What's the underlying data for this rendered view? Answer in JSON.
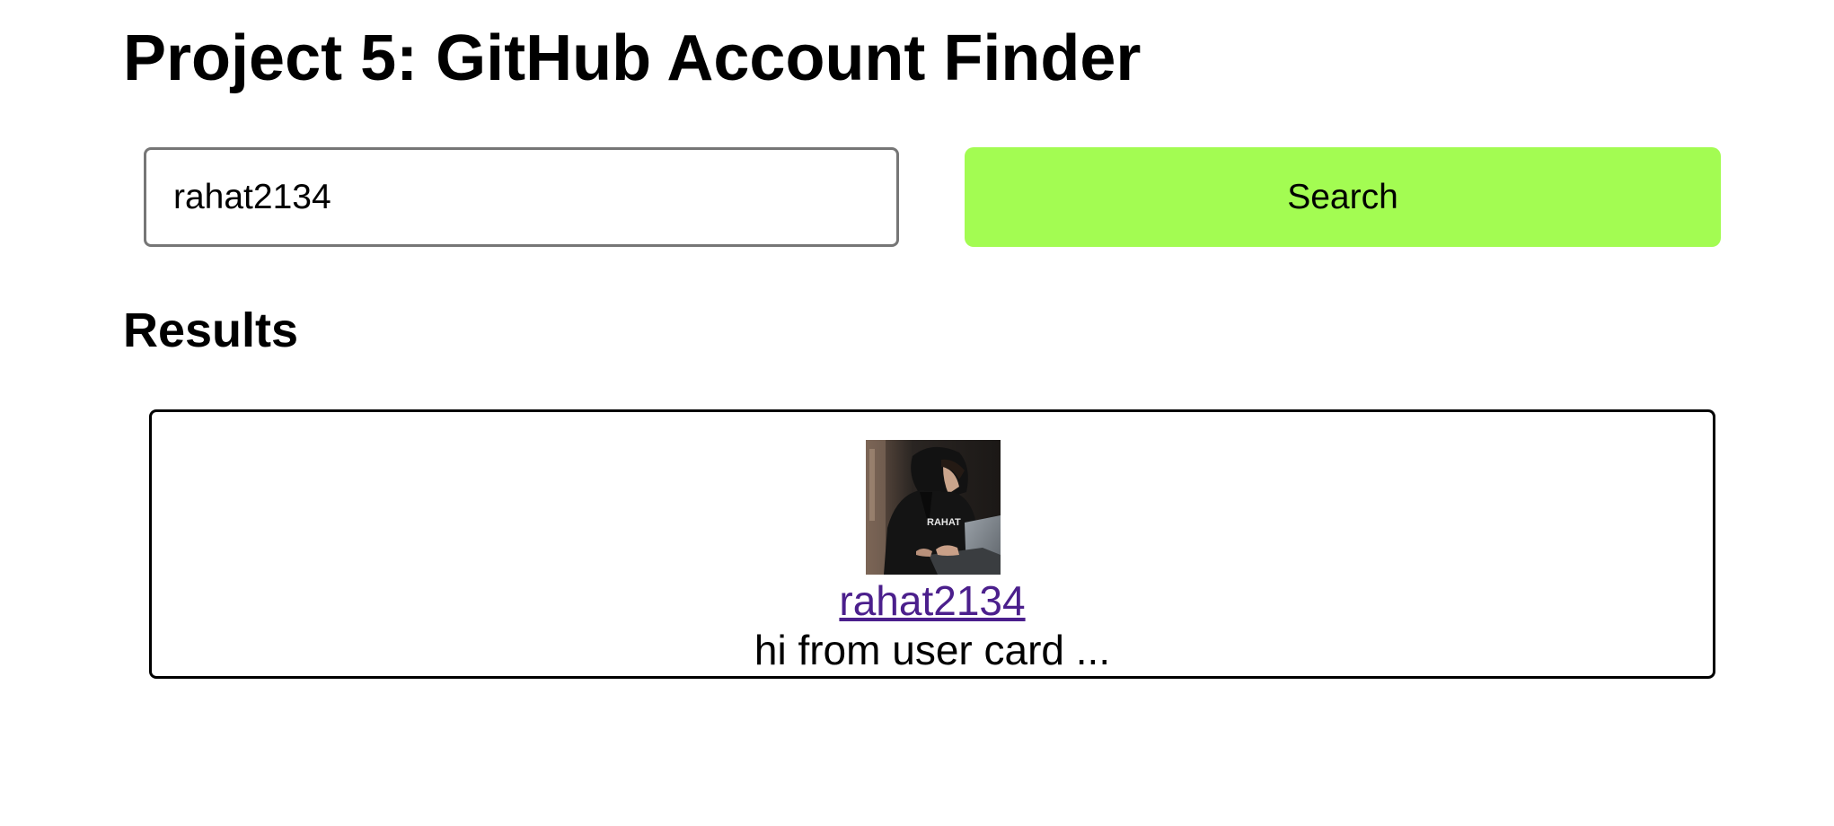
{
  "header": {
    "title": "Project 5: GitHub Account Finder"
  },
  "search": {
    "value": "rahat2134",
    "button_label": "Search"
  },
  "results": {
    "heading": "Results",
    "card": {
      "username": "rahat2134",
      "text": "hi from user card ...",
      "avatar_lettering": "RAHAT"
    }
  },
  "colors": {
    "button_bg": "#a3fc52",
    "link": "#4b1f8c",
    "input_border": "#767676",
    "card_border": "#000000"
  }
}
